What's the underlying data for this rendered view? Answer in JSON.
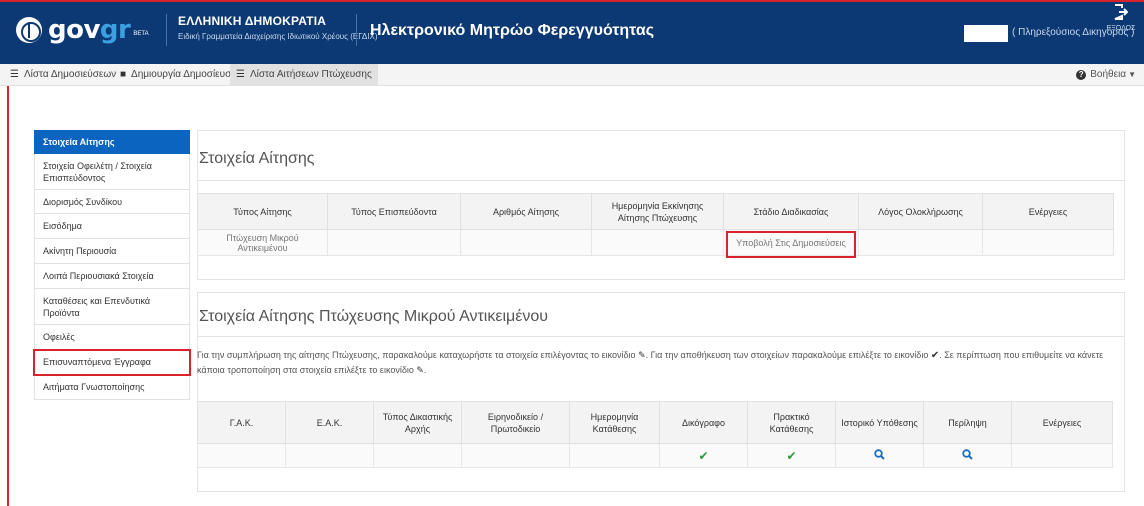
{
  "header": {
    "logo_text_main": "gov",
    "logo_text_accent": "gr",
    "logo_badge": "BETA",
    "org_name": "ΕΛΛΗΝΙΚΗ ΔΗΜΟΚΡΑΤΙΑ",
    "org_subtitle": "Ειδική Γραμματεία Διαχείρισης Ιδιωτικού Χρέους (ΕΓΔΙΧ)",
    "app_title": "Ηλεκτρονικό Μητρώο Φερεγγυότητας",
    "user_role": "( Πληρεξούσιος Δικηγόρος )",
    "logout_label": "ΕΞΟΔΟΣ"
  },
  "navbar": {
    "items": [
      {
        "label": "Λίστα Δημοσιεύσεων",
        "icon": "list-icon"
      },
      {
        "label": "Δημιουργία Δημοσίευσης",
        "icon": "document-icon"
      },
      {
        "label": "Λίστα Αιτήσεων Πτώχευσης",
        "icon": "list-icon"
      }
    ],
    "help_label": "Βοήθεια"
  },
  "sidebar": {
    "items": [
      {
        "label": "Στοιχεία Αίτησης"
      },
      {
        "label": "Στοιχεία Οφειλέτη / Στοιχεία Επισπεύδοντος"
      },
      {
        "label": "Διορισμός Συνδίκου"
      },
      {
        "label": "Εισόδημα"
      },
      {
        "label": "Ακίνητη Περιουσία"
      },
      {
        "label": "Λοιπά Περιουσιακά Στοιχεία"
      },
      {
        "label": "Καταθέσεις και Επενδυτικά Προϊόντα"
      },
      {
        "label": "Οφειλές"
      },
      {
        "label": "Επισυναπτόμενα Έγγραφα"
      },
      {
        "label": "Αιτήματα Γνωστοποίησης"
      }
    ]
  },
  "section1": {
    "title": "Στοιχεία Αίτησης",
    "headers": [
      "Τύπος Αίτησης",
      "Τύπος Επισπεύδοντα",
      "Αριθμός Αίτησης",
      "Ημερομηνία Εκκίνησης Αίτησης Πτώχευσης",
      "Στάδιο Διαδικασίας",
      "Λόγος Ολοκλήρωσης",
      "Ενέργειες"
    ],
    "row": {
      "type": "Πτώχευση Μικρού Αντικειμένου",
      "stage": "Υποβολή Στις Δημοσιεύσεις"
    }
  },
  "section2": {
    "title": "Στοιχεία Αίτησης Πτώχευσης Μικρού Αντικειμένου",
    "info_part1": "Για την συμπλήρωση της αίτησης Πτώχευσης, παρακαλούμε καταχωρήστε τα στοιχεία επιλέγοντας το εικονίδιο",
    "info_part2": ". Για την αποθήκευση των στοιχείων παρακαλούμε επιλέξτε το εικονίδιο",
    "info_part3": ". Σε περίπτωση που επιθυμείτε να κάνετε κάποια τροποποίηση στα στοιχεία επιλέξτε το εικονίδιο",
    "info_part4": ".",
    "headers": [
      "Γ.Α.Κ.",
      "Ε.Α.Κ.",
      "Τύπος Δικαστικής Αρχής",
      "Ειρηνοδικείο / Πρωτοδικείο",
      "Ημερομηνία Κατάθεσης",
      "Δικόγραφο",
      "Πρακτικό Κατάθεσης",
      "Ιστορικό Υπόθεσης",
      "Περίληψη",
      "Ενέργειες"
    ]
  },
  "colors": {
    "header_bg": "#0c3974",
    "sidebar_active": "#0c64c1",
    "highlight_red": "#d8232a",
    "check_green": "#2a9a3a",
    "search_blue": "#1a6fc4"
  }
}
